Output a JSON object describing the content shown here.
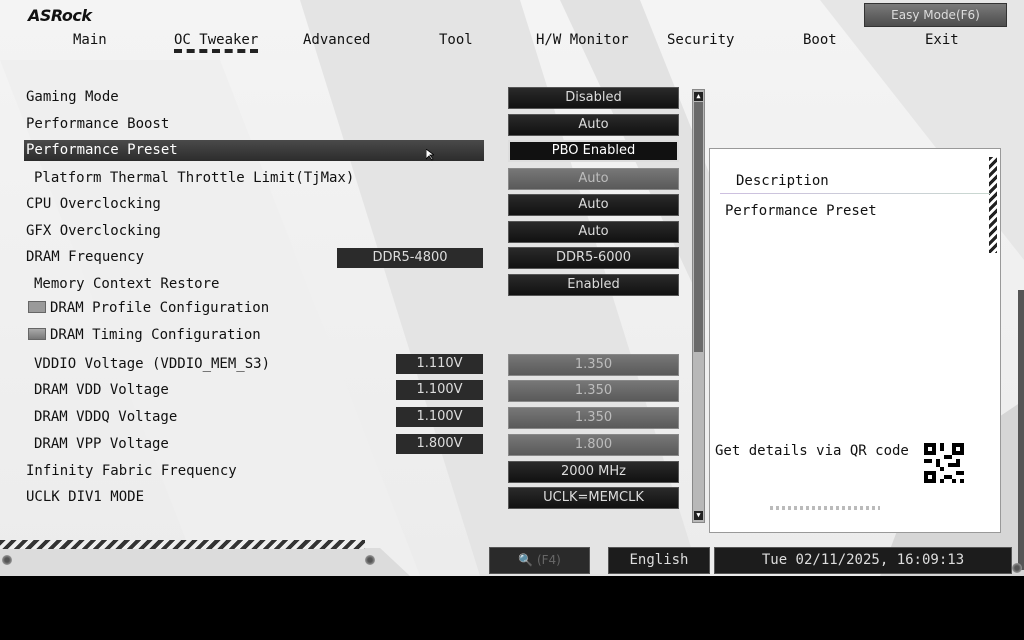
{
  "header": {
    "logo": "ASRock",
    "easy_mode_label": "Easy Mode(F6)"
  },
  "tabs": [
    {
      "label": "Main",
      "active": false
    },
    {
      "label": "OC Tweaker",
      "active": true
    },
    {
      "label": "Advanced",
      "active": false
    },
    {
      "label": "Tool",
      "active": false
    },
    {
      "label": "H/W Monitor",
      "active": false
    },
    {
      "label": "Security",
      "active": false
    },
    {
      "label": "Boot",
      "active": false
    },
    {
      "label": "Exit",
      "active": false
    }
  ],
  "settings": [
    {
      "label": "Gaming Mode",
      "value": "Disabled"
    },
    {
      "label": "Performance Boost",
      "value": "Auto"
    },
    {
      "label": "Performance Preset",
      "value": "PBO Enabled",
      "selected": true
    },
    {
      "label": "Platform Thermal Throttle Limit(TjMax)",
      "value": "Auto",
      "disabled": true
    },
    {
      "label": "CPU Overclocking",
      "value": "Auto"
    },
    {
      "label": "GFX Overclocking",
      "value": "Auto"
    },
    {
      "label": "DRAM Frequency",
      "current": "DDR5-4800",
      "value": "DDR5-6000"
    },
    {
      "label": "Memory Context Restore",
      "value": "Enabled"
    },
    {
      "label": "DRAM Profile Configuration",
      "folder": true
    },
    {
      "label": "DRAM Timing Configuration",
      "folder": true
    },
    {
      "label": "VDDIO Voltage (VDDIO_MEM_S3)",
      "current": "1.110V",
      "value": "1.350",
      "disabled": true
    },
    {
      "label": "DRAM VDD Voltage",
      "current": "1.100V",
      "value": "1.350",
      "disabled": true
    },
    {
      "label": "DRAM VDDQ Voltage",
      "current": "1.100V",
      "value": "1.350",
      "disabled": true
    },
    {
      "label": "DRAM VPP Voltage",
      "current": "1.800V",
      "value": "1.800",
      "disabled": true
    },
    {
      "label": "Infinity Fabric Frequency",
      "value": "2000 MHz"
    },
    {
      "label": "UCLK DIV1 MODE",
      "value": "UCLK=MEMCLK"
    }
  ],
  "description": {
    "title": "Description",
    "text": "Performance Preset",
    "qr_text": "Get details via QR code"
  },
  "footer": {
    "search_label": "(F4)",
    "language": "English",
    "datetime": "Tue 02/11/2025, 16:09:13"
  }
}
